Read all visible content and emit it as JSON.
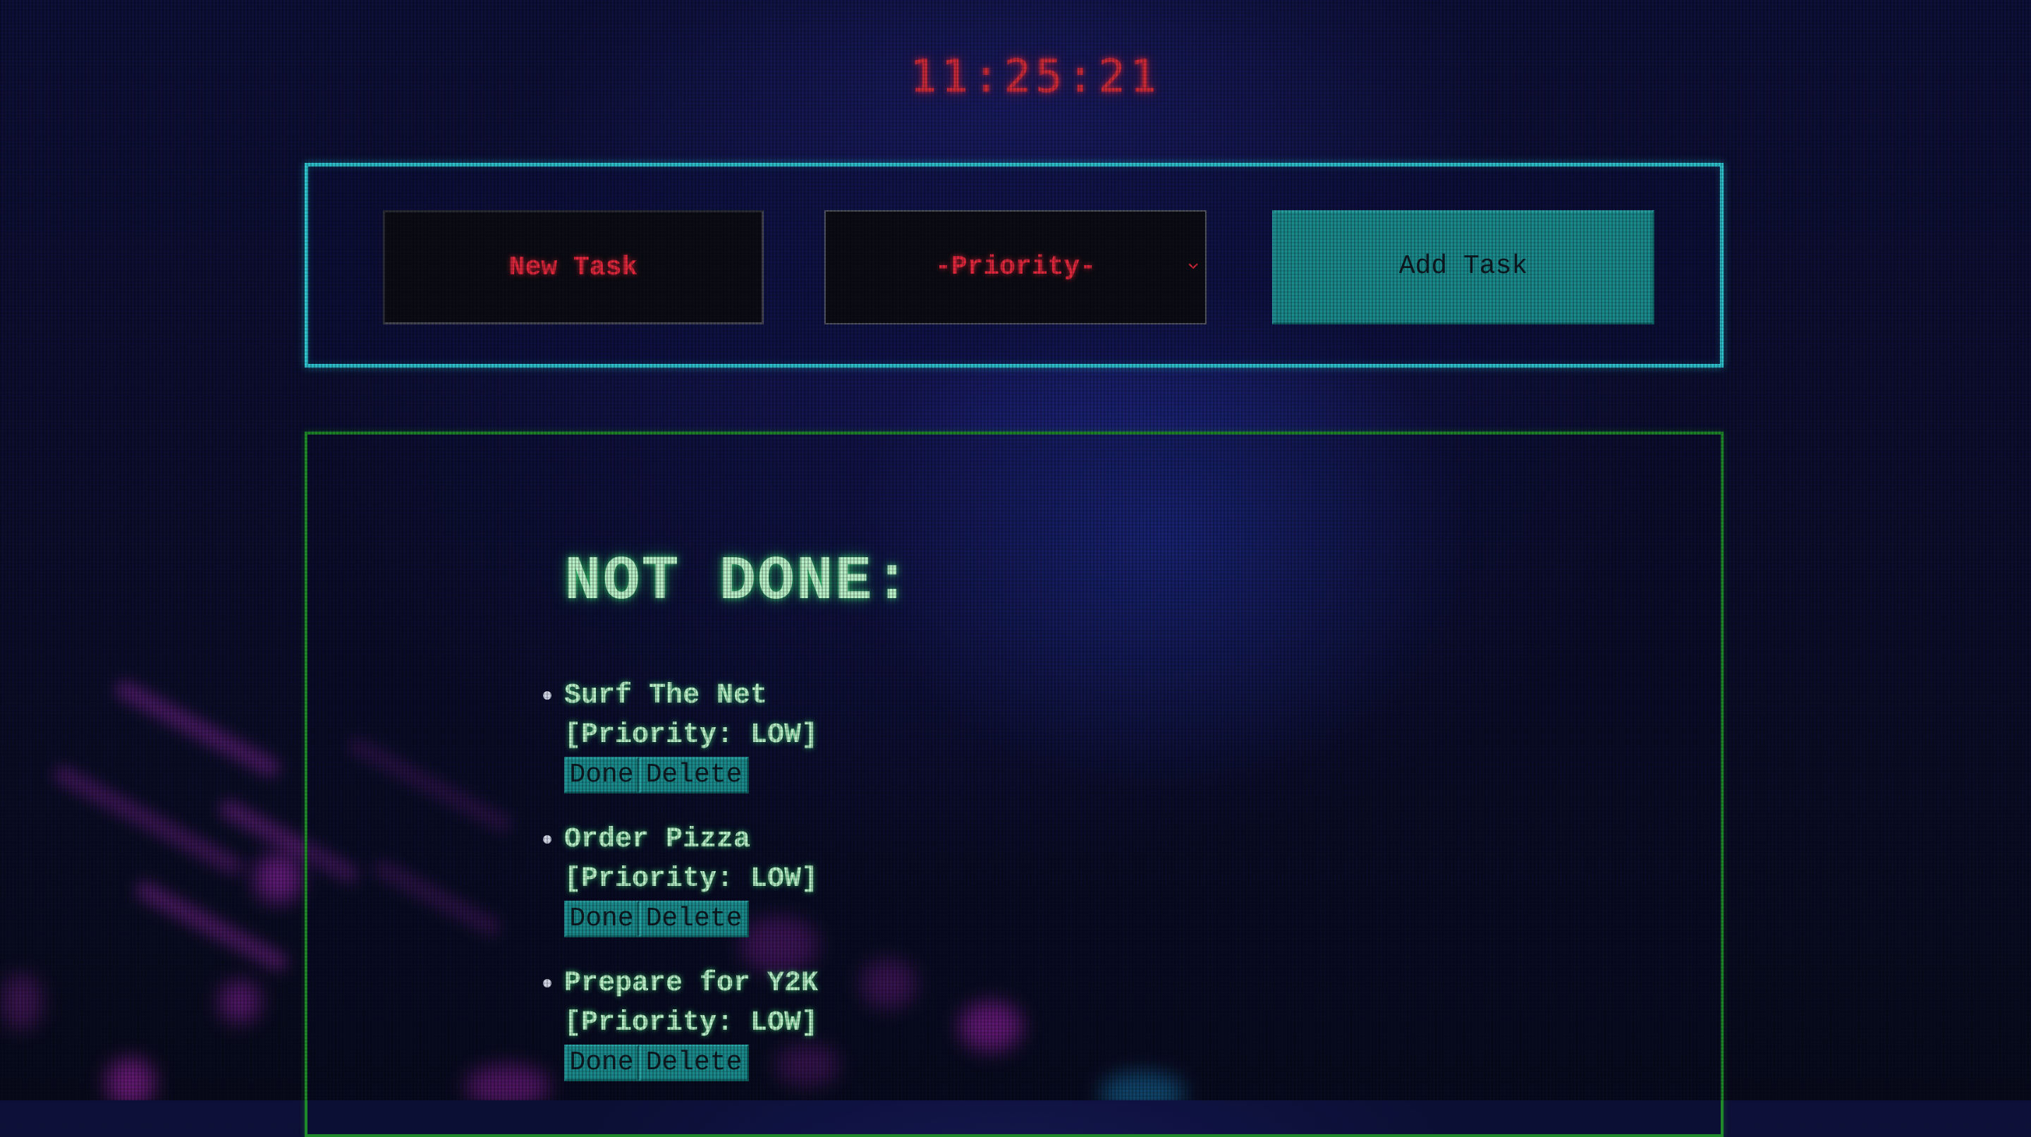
{
  "clock": {
    "time": "11:25:21"
  },
  "add_form": {
    "task_placeholder": "New Task",
    "priority_value": "-Priority-",
    "add_button_label": "Add Task"
  },
  "list": {
    "heading": "NOT DONE:",
    "tasks": [
      {
        "name": "Surf The Net",
        "priority": "[Priority: LOW]",
        "done_label": "Done",
        "delete_label": "Delete"
      },
      {
        "name": "Order Pizza",
        "priority": "[Priority: LOW]",
        "done_label": "Done",
        "delete_label": "Delete"
      },
      {
        "name": "Prepare for Y2K",
        "priority": "[Priority: LOW]",
        "done_label": "Done",
        "delete_label": "Delete"
      }
    ]
  },
  "colors": {
    "clock_red": "#c82a3a",
    "input_text_red": "#e0283c",
    "panel_cyan_border": "#2fc6d1",
    "list_green_border": "#1f8a2a",
    "button_teal": "#1a8a8c",
    "task_text_green": "#b8f0c8"
  },
  "icons": {
    "select_arrow": "chevron-down-icon",
    "list_bullet": "bullet-icon"
  }
}
